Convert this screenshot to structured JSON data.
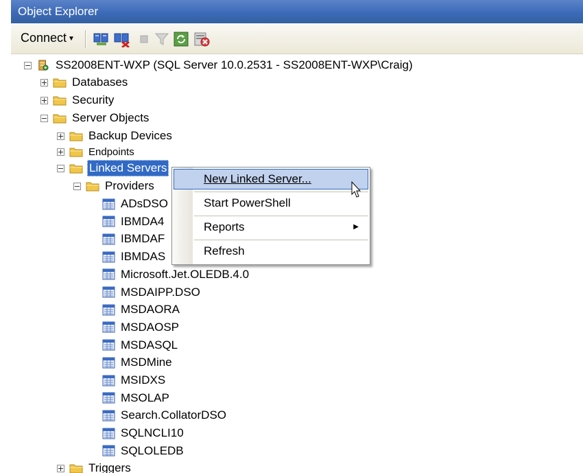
{
  "window": {
    "title": "Object Explorer"
  },
  "toolbar": {
    "connect_label": "Connect",
    "buttons": [
      "connect-object-explorer-icon",
      "disconnect-icon",
      "stop-icon",
      "filter-icon",
      "refresh-icon",
      "delete-icon"
    ]
  },
  "tree": {
    "server": "SS2008ENT-WXP (SQL Server 10.0.2531 - SS2008ENT-WXP\\Craig)",
    "databases": "Databases",
    "security": "Security",
    "server_objects": "Server Objects",
    "backup_devices": "Backup Devices",
    "endpoints": "Endpoints",
    "linked_servers": "Linked Servers",
    "providers": "Providers",
    "provider_items": [
      "ADsDSO",
      "IBMDA4",
      "IBMDAF",
      "IBMDAS",
      "Microsoft.Jet.OLEDB.4.0",
      "MSDAIPP.DSO",
      "MSDAORA",
      "MSDAOSP",
      "MSDASQL",
      "MSDMine",
      "MSIDXS",
      "MSOLAP",
      "Search.CollatorDSO",
      "SQLNCLI10",
      "SQLOLEDB"
    ],
    "triggers": "Triggers"
  },
  "context_menu": {
    "items": [
      "New Linked Server...",
      "Start PowerShell",
      "Reports",
      "Refresh"
    ]
  },
  "colors": {
    "title_bar": "#3d6ab7",
    "selection": "#316ac5",
    "menu_highlight": "#c1d2ee"
  }
}
